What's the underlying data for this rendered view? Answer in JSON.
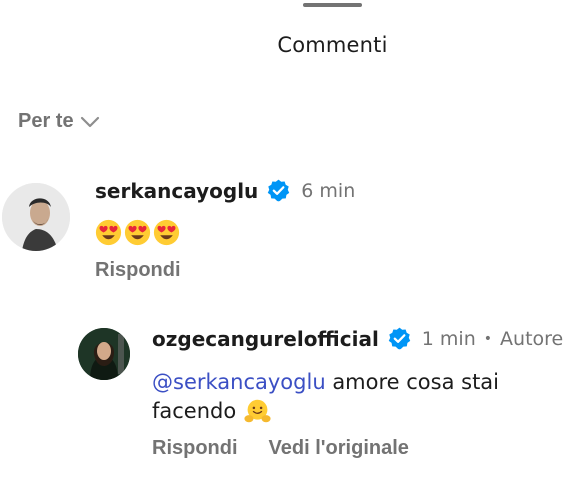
{
  "sheet": {
    "title": "Commenti"
  },
  "sort": {
    "label": "Per te"
  },
  "comments": [
    {
      "username": "serkancayoglu",
      "time": "6 min",
      "emojis": [
        "heart-eyes-emoji",
        "heart-eyes-emoji",
        "heart-eyes-emoji"
      ],
      "reply_label": "Rispondi"
    },
    {
      "username": "ozgecangurelofficial",
      "time": "1 min",
      "separator": "•",
      "author_badge": "Autore",
      "mention": "@serkancayoglu",
      "text_line1": " amore cosa stai",
      "text_line2": "facendo",
      "emoji": "hugging-face-emoji",
      "reply_label": "Rispondi",
      "view_original_label": "Vedi l'originale"
    }
  ],
  "colors": {
    "accent_blue": "#0095f6",
    "mention": "#3b4fc4",
    "secondary_text": "#737373"
  }
}
